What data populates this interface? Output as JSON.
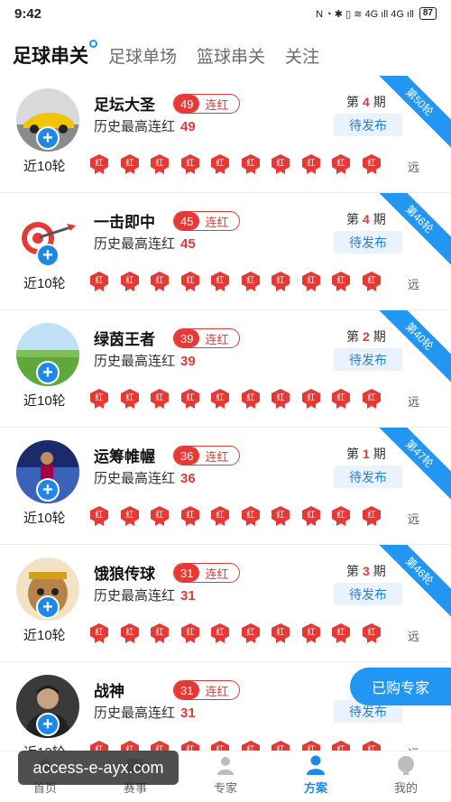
{
  "status_bar": {
    "time": "9:42",
    "icons": "N ◔ ✱ ▯ ≋ 4G ıll 4G ıll",
    "battery": "87"
  },
  "top_tabs": [
    {
      "label": "足球串关",
      "active": true
    },
    {
      "label": "足球单场",
      "active": false
    },
    {
      "label": "篮球串关",
      "active": false
    },
    {
      "label": "关注",
      "active": false
    }
  ],
  "common": {
    "history_label": "历史最高连红",
    "streak_suffix": "连红",
    "issue_prefix": "第",
    "issue_suffix": "期",
    "pending": "待发布",
    "recent_label": "近10轮",
    "result_char": "红",
    "far": "远",
    "follow": "+"
  },
  "experts": [
    {
      "name": "足坛大圣",
      "streak": "49",
      "history": "49",
      "issue": "4",
      "round": "第50轮",
      "avatar": "sports-car",
      "results": 10
    },
    {
      "name": "一击即中",
      "streak": "45",
      "history": "45",
      "issue": "4",
      "round": "第46轮",
      "avatar": "dart-target",
      "results": 10
    },
    {
      "name": "绿茵王者",
      "streak": "39",
      "history": "39",
      "issue": "2",
      "round": "第40轮",
      "avatar": "grass-field",
      "results": 10
    },
    {
      "name": "运筹帷幄",
      "streak": "36",
      "history": "36",
      "issue": "1",
      "round": "第47轮",
      "avatar": "soccer-player",
      "results": 10
    },
    {
      "name": "饿狼传球",
      "streak": "31",
      "history": "31",
      "issue": "3",
      "round": "第46轮",
      "avatar": "monkey-king",
      "results": 10
    },
    {
      "name": "战神",
      "streak": "31",
      "history": "31",
      "issue": "",
      "round": "",
      "avatar": "man-portrait",
      "results": 10
    }
  ],
  "purchased": "已购专家",
  "watermark": "access-e-ayx.com",
  "bottom_nav": [
    {
      "label": "首页",
      "icon": "home-icon",
      "active": false
    },
    {
      "label": "赛事",
      "icon": "events-icon",
      "active": false
    },
    {
      "label": "专家",
      "icon": "expert-icon",
      "active": false
    },
    {
      "label": "方案",
      "icon": "plan-icon",
      "active": true
    },
    {
      "label": "我的",
      "icon": "profile-icon",
      "active": false
    }
  ],
  "colors": {
    "accent": "#2196f3",
    "red": "#e53935",
    "pending_bg": "#eaf3fc"
  }
}
